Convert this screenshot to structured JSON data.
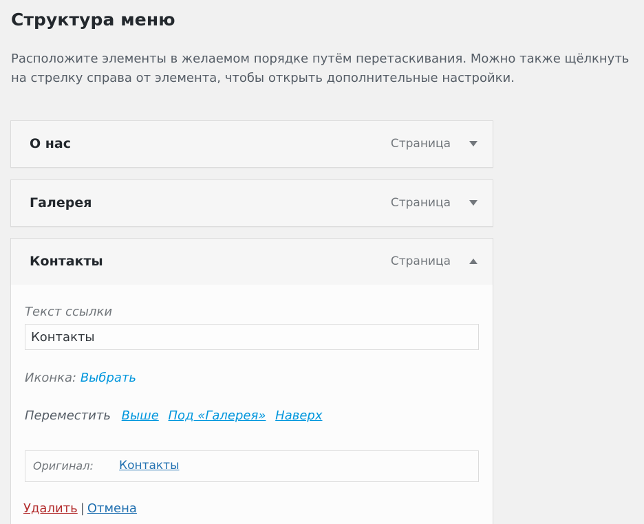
{
  "page": {
    "title": "Структура меню",
    "description": "Расположите элементы в желаемом порядке путём перетаскивания. Можно также щёлкнуть на стрелку справа от элемента, чтобы открыть дополнительные настройки."
  },
  "menu_items": [
    {
      "title": "О нас",
      "type": "Страница",
      "toggle_icon": "arrow-down-icon",
      "expanded": false
    },
    {
      "title": "Галерея",
      "type": "Страница",
      "toggle_icon": "arrow-down-icon",
      "expanded": false
    },
    {
      "title": "Контакты",
      "type": "Страница",
      "toggle_icon": "arrow-up-icon",
      "expanded": true
    }
  ],
  "settings": {
    "link_text_label": "Текст ссылки",
    "link_text_value": "Контакты",
    "icon_label": "Иконка:",
    "icon_choose_link": "Выбрать",
    "move_label": "Переместить",
    "move_links": [
      "Выше",
      "Под «Галерея»",
      "Наверх"
    ],
    "original_label": "Оригинал:",
    "original_link": "Контакты",
    "delete_link": "Удалить",
    "separator": "|",
    "cancel_link": "Отмена"
  },
  "colors": {
    "background": "#f1f1f1",
    "link": "#0096dd",
    "delete": "#b32d2e"
  }
}
